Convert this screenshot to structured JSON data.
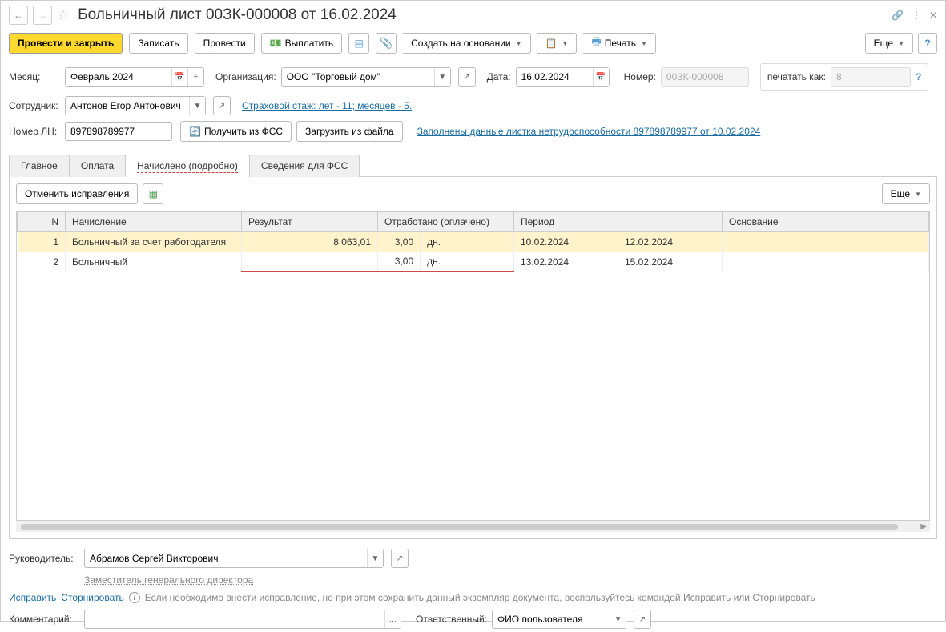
{
  "header": {
    "title": "Больничный лист 00ЗК-000008 от 16.02.2024"
  },
  "toolbar": {
    "post_close": "Провести и закрыть",
    "save": "Записать",
    "post": "Провести",
    "pay": "Выплатить",
    "create_based": "Создать на основании",
    "print": "Печать",
    "more": "Еще"
  },
  "fields": {
    "month_label": "Месяц:",
    "month_value": "Февраль 2024",
    "org_label": "Организация:",
    "org_value": "ООО \"Торговый дом\"",
    "date_label": "Дата:",
    "date_value": "16.02.2024",
    "number_label": "Номер:",
    "number_value": "00ЗК-000008",
    "print_as_label": "печатать как:",
    "print_as_value": "8",
    "employee_label": "Сотрудник:",
    "employee_value": "Антонов Егор Антонович",
    "insurance_link": "Страховой стаж: лет - 11; месяцев - 5.",
    "ln_label": "Номер ЛН:",
    "ln_value": "897898789977",
    "get_fss": "Получить из ФСС",
    "load_file": "Загрузить из файла",
    "filled_link": "Заполнены данные листка нетрудоспособности 897898789977 от 10.02.2024"
  },
  "tabs": {
    "main": "Главное",
    "payment": "Оплата",
    "accrued": "Начислено (подробно)",
    "fss": "Сведения для ФСС"
  },
  "tab_toolbar": {
    "cancel": "Отменить исправления",
    "more": "Еще"
  },
  "table": {
    "headers": {
      "n": "N",
      "accrual": "Начисление",
      "result": "Результат",
      "worked": "Отработано (оплачено)",
      "period": "Период",
      "basis": "Основание"
    },
    "rows": [
      {
        "n": "1",
        "accrual": "Больничный за счет работодателя",
        "result": "8 063,01",
        "worked_n": "3,00",
        "worked_u": "дн.",
        "period1": "10.02.2024",
        "period2": "12.02.2024"
      },
      {
        "n": "2",
        "accrual": "Больничный",
        "result": "",
        "worked_n": "3,00",
        "worked_u": "дн.",
        "period1": "13.02.2024",
        "period2": "15.02.2024"
      }
    ]
  },
  "footer": {
    "manager_label": "Руководитель:",
    "manager_value": "Абрамов Сергей Викторович",
    "manager_position": "Заместитель генерального директора",
    "fix_link": "Исправить",
    "reverse_link": "Сторнировать",
    "info_text": "Если необходимо внести исправление, но при этом сохранить данный экземпляр документа, воспользуйтесь командой Исправить или Сторнировать",
    "comment_label": "Комментарий:",
    "responsible_label": "Ответственный:",
    "responsible_value": "ФИО пользователя"
  }
}
